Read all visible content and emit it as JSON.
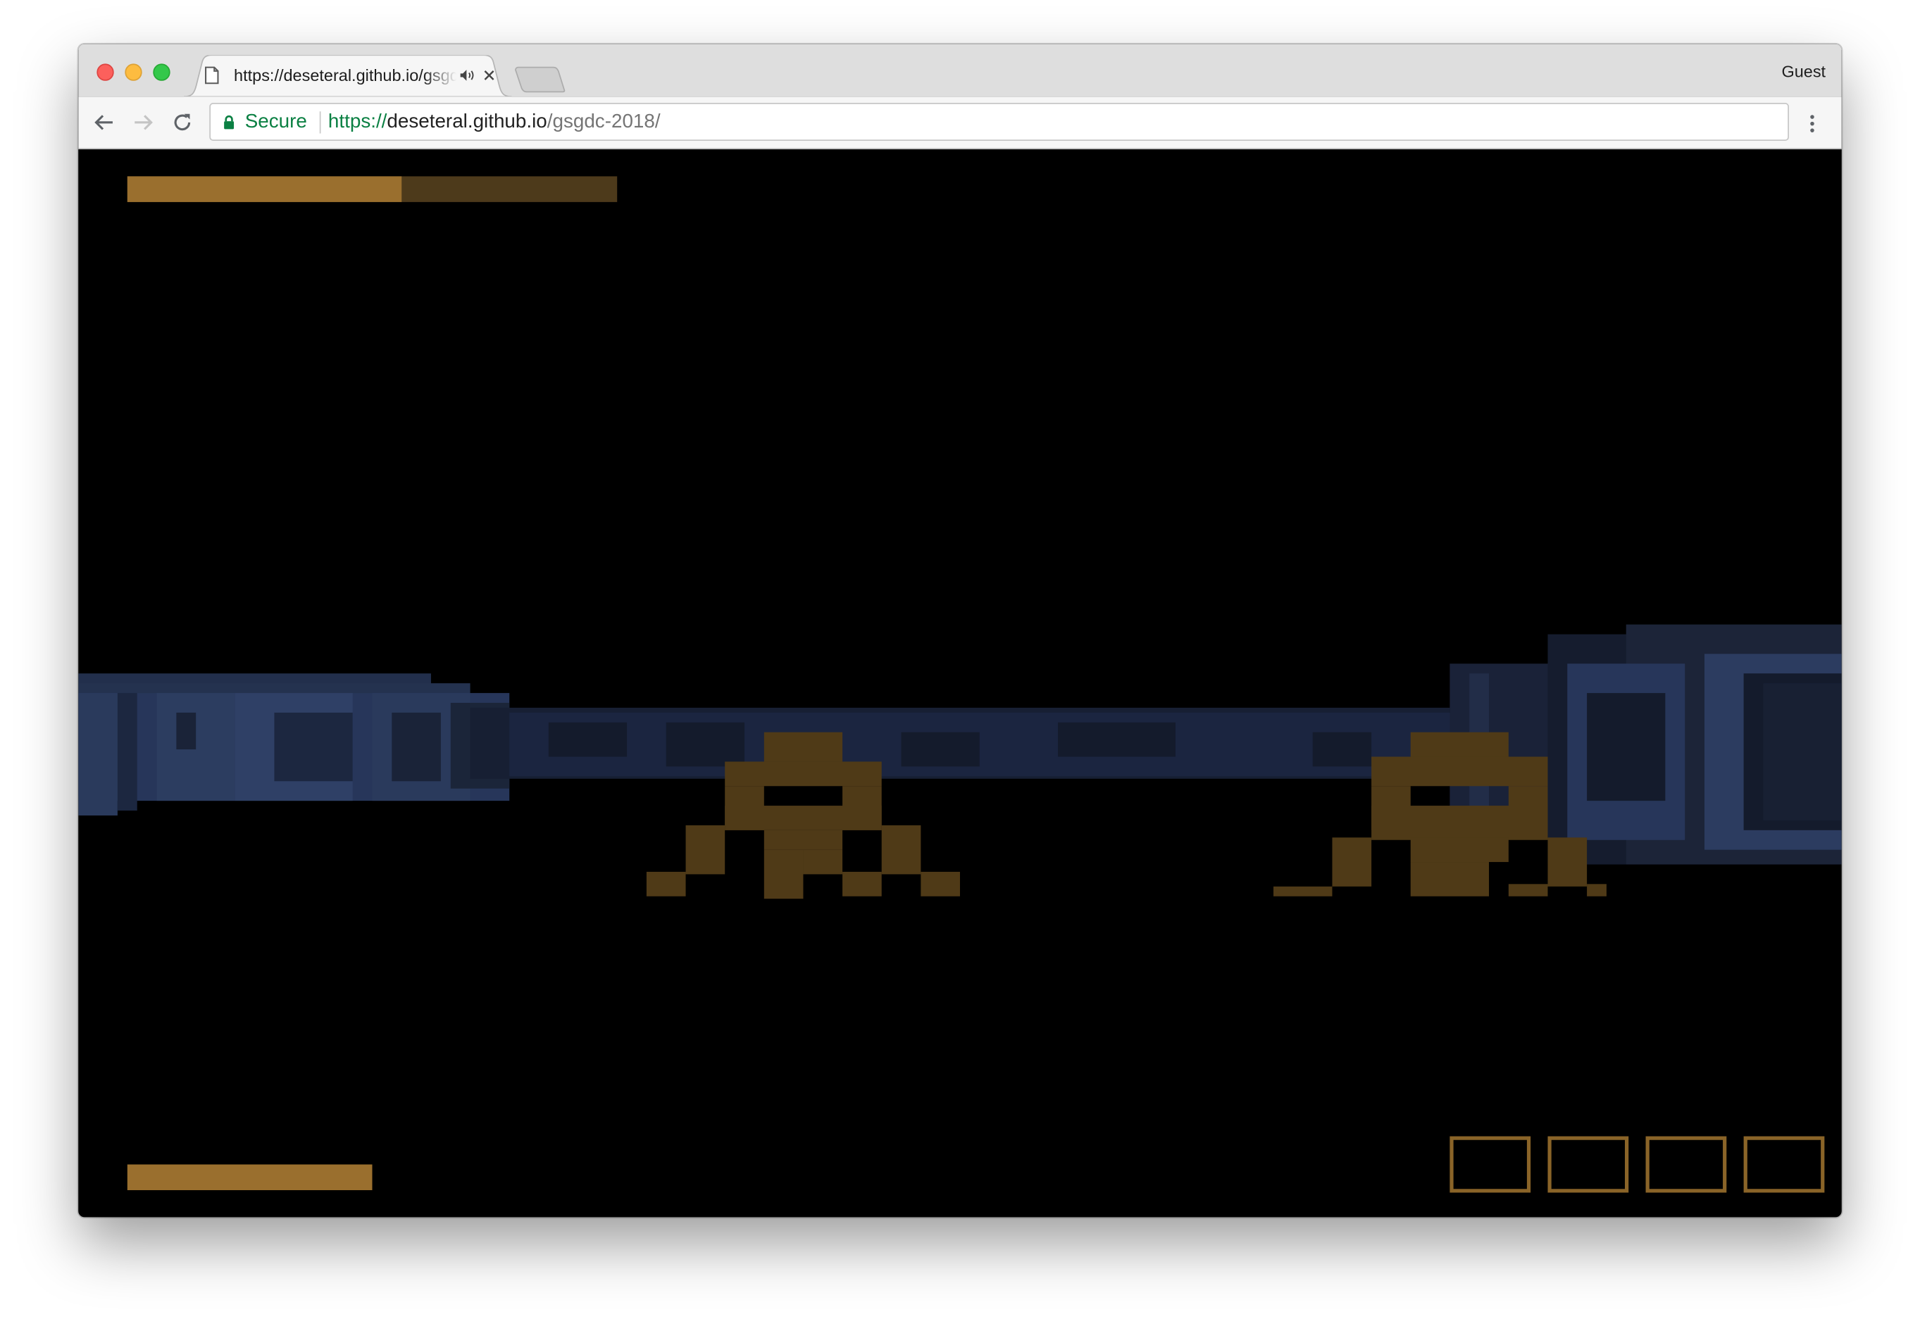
{
  "browser": {
    "tab": {
      "title": "https://deseteral.github.io/gsgdc-2018/",
      "icons": [
        "document-icon",
        "audio-playing-icon",
        "close-icon"
      ]
    },
    "profile_label": "Guest",
    "toolbar": {
      "icons": [
        "back-arrow-icon",
        "forward-arrow-icon",
        "reload-icon",
        "lock-icon",
        "menu-dots-icon"
      ],
      "security_label": "Secure",
      "url_scheme": "https://",
      "url_host": "deseteral.github.io",
      "url_path": "/gsgdc-2018/"
    }
  },
  "game": {
    "colors": {
      "background": "#000000",
      "bar_fill": "#9a6f2e",
      "bar_track": "#4d3a1b",
      "enemy": "#4f3a17",
      "tunnel_light": "#2a3a5c",
      "tunnel_dark": "#141b2c",
      "slot_border": "#8a6428"
    },
    "top_bar_fill_percent": 56,
    "bottom_bar_fill_percent": 100,
    "inventory_slot_count": 4,
    "enemy_count": 2
  }
}
